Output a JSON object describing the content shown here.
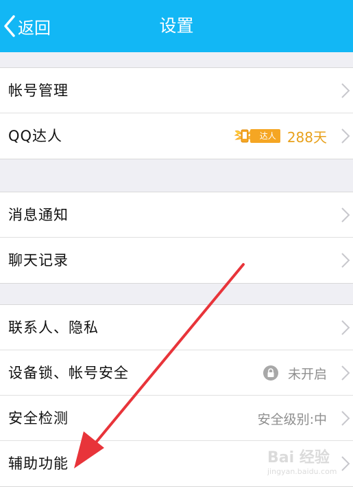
{
  "header": {
    "back_label": "返回",
    "title": "设置"
  },
  "groups": [
    {
      "rows": [
        {
          "label": "帐号管理"
        },
        {
          "label": "QQ达人",
          "badge_text": "达人",
          "days": "288天"
        }
      ]
    },
    {
      "rows": [
        {
          "label": "消息通知"
        },
        {
          "label": "聊天记录"
        }
      ]
    },
    {
      "rows": [
        {
          "label": "联系人、隐私"
        },
        {
          "label": "设备锁、帐号安全",
          "value": "未开启"
        },
        {
          "label": "安全检测",
          "value": "安全级别:中"
        },
        {
          "label": "辅助功能"
        }
      ]
    }
  ],
  "colors": {
    "nav_bar": "#12b7f5",
    "annotation_arrow": "#e8343a",
    "badge": "#f5a623"
  },
  "watermark": {
    "line1": "Bai 经验",
    "line2": "jingyan.baidu.com"
  }
}
